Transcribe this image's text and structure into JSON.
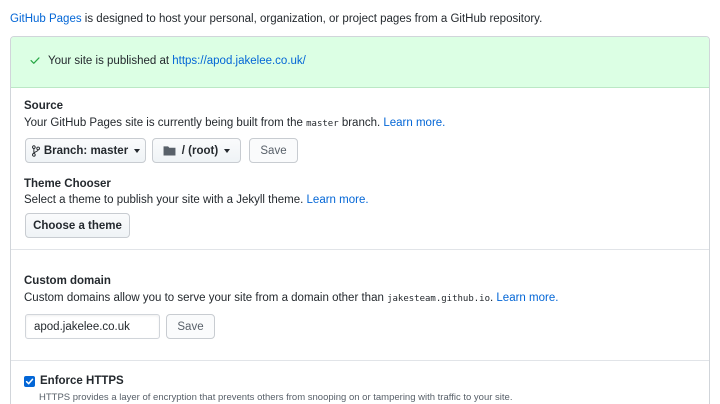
{
  "intro": {
    "link": "GitHub Pages",
    "text": " is designed to host your personal, organization, or project pages from a GitHub repository."
  },
  "flash": {
    "text": "Your site is published at ",
    "url": "https://apod.jakelee.co.uk/"
  },
  "source": {
    "title": "Source",
    "desc_before": "Your GitHub Pages site is currently being built from the ",
    "branch_code": "master",
    "desc_after": " branch. ",
    "learn_more": "Learn more.",
    "branch_button": "Branch: master",
    "folder_button": "/ (root)",
    "save_button": "Save"
  },
  "theme": {
    "title": "Theme Chooser",
    "desc": "Select a theme to publish your site with a Jekyll theme. ",
    "learn_more": "Learn more.",
    "button": "Choose a theme"
  },
  "custom_domain": {
    "title": "Custom domain",
    "desc_before": "Custom domains allow you to serve your site from a domain other than ",
    "code": "jakesteam.github.io",
    "desc_after": ". ",
    "learn_more": "Learn more.",
    "input_value": "apod.jakelee.co.uk",
    "save_button": "Save"
  },
  "https": {
    "label": "Enforce HTTPS",
    "desc": "HTTPS provides a layer of encryption that prevents others from snooping on or tampering with traffic to your site."
  },
  "colors": {
    "link": "#0366d6",
    "success_bg": "#dcffe4",
    "success_icon": "#28a745",
    "checkbox": "#0366d6"
  }
}
